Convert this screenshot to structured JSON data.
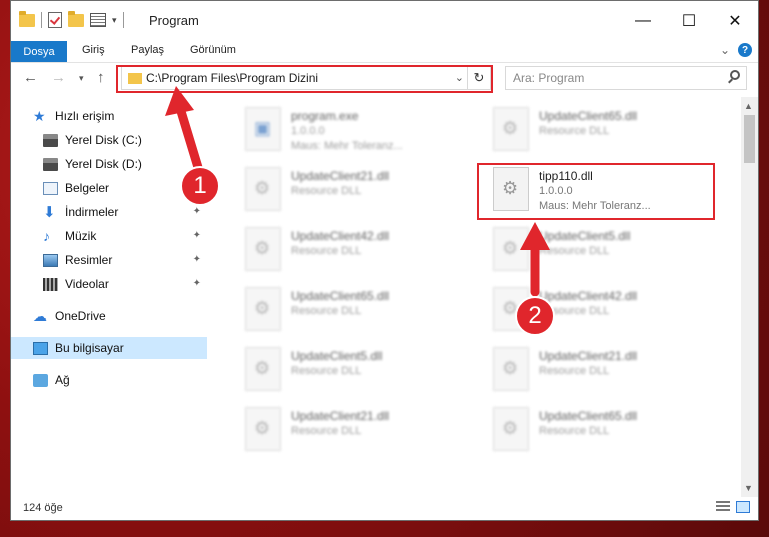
{
  "window": {
    "title": "Program",
    "controls": {
      "minimize": "—",
      "maximize": "☐",
      "close": "✕"
    }
  },
  "ribbon": {
    "tabs": [
      "Dosya",
      "Giriş",
      "Paylaş",
      "Görünüm"
    ],
    "help": "?"
  },
  "address": {
    "path": "C:\\Program Files\\Program Dizini"
  },
  "search": {
    "placeholder": "Ara: Program"
  },
  "sidebar": {
    "items": [
      {
        "label": "Hızlı erişim",
        "icon": "star-icon"
      },
      {
        "label": "Yerel Disk (C:)",
        "icon": "disk-icon"
      },
      {
        "label": "Yerel Disk (D:)",
        "icon": "disk-icon"
      },
      {
        "label": "Belgeler",
        "icon": "documents-icon"
      },
      {
        "label": "İndirmeler",
        "icon": "download-icon"
      },
      {
        "label": "Müzik",
        "icon": "music-icon"
      },
      {
        "label": "Resimler",
        "icon": "pictures-icon"
      },
      {
        "label": "Videolar",
        "icon": "video-icon"
      },
      {
        "label": "OneDrive",
        "icon": "cloud-icon"
      },
      {
        "label": "Bu bilgisayar",
        "icon": "computer-icon"
      },
      {
        "label": "Ağ",
        "icon": "network-icon"
      }
    ]
  },
  "files": [
    {
      "name": "program.exe",
      "line1": "1.0.0.0",
      "line2": "Maus: Mehr Toleranz..."
    },
    {
      "name": "UpdateClient65.dll",
      "line1": "Resource DLL",
      "line2": ""
    },
    {
      "name": "UpdateClient21.dll",
      "line1": "Resource DLL",
      "line2": ""
    },
    {
      "name": "tipp110.dll",
      "line1": "1.0.0.0",
      "line2": "Maus: Mehr Toleranz..."
    },
    {
      "name": "UpdateClient42.dll",
      "line1": "Resource DLL",
      "line2": ""
    },
    {
      "name": "UpdateClient5.dll",
      "line1": "Resource DLL",
      "line2": ""
    },
    {
      "name": "UpdateClient65.dll",
      "line1": "Resource DLL",
      "line2": ""
    },
    {
      "name": "UpdateClient42.dll",
      "line1": "Resource DLL",
      "line2": ""
    },
    {
      "name": "UpdateClient5.dll",
      "line1": "Resource DLL",
      "line2": ""
    },
    {
      "name": "UpdateClient21.dll",
      "line1": "Resource DLL",
      "line2": ""
    },
    {
      "name": "UpdateClient21.dll",
      "line1": "Resource DLL",
      "line2": ""
    },
    {
      "name": "UpdateClient65.dll",
      "line1": "Resource DLL",
      "line2": ""
    }
  ],
  "status": {
    "count": "124 öğe"
  },
  "callouts": [
    "1",
    "2"
  ],
  "colors": {
    "accent": "#1979ca",
    "highlight": "#e0262c",
    "selected": "#cce8ff"
  }
}
